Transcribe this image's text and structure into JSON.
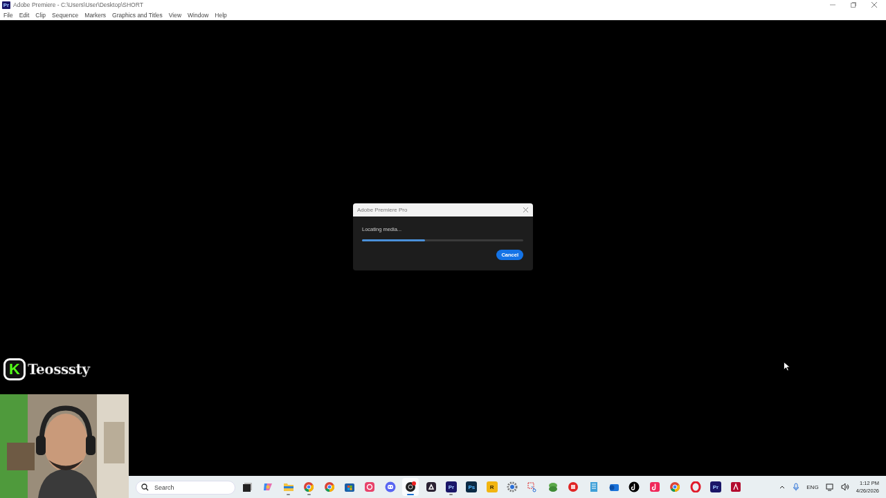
{
  "window": {
    "app_badge": "Pr",
    "title": "Adobe Premiere - C:\\Users\\User\\Desktop\\SHORT"
  },
  "menu": [
    "File",
    "Edit",
    "Clip",
    "Sequence",
    "Markers",
    "Graphics and Titles",
    "View",
    "Window",
    "Help"
  ],
  "dialog": {
    "title": "Adobe Premiere Pro",
    "message": "Locating media...",
    "level": 0.39,
    "button": "Cancel"
  },
  "overlay": {
    "logo_letter": "K",
    "channel": "Teosssty"
  },
  "taskbar": {
    "search": {
      "placeholder": "Search"
    },
    "apps": [
      {
        "kind": "taskview",
        "running": false,
        "selected": false
      },
      {
        "kind": "copilot",
        "running": false,
        "selected": false
      },
      {
        "kind": "folder",
        "running": true,
        "selected": false
      },
      {
        "kind": "chrome",
        "running": true,
        "selected": false
      },
      {
        "kind": "chrome",
        "running": false,
        "selected": false
      },
      {
        "kind": "store",
        "running": false,
        "selected": false
      },
      {
        "kind": "creative",
        "running": false,
        "selected": false
      },
      {
        "kind": "discord",
        "running": false,
        "selected": false
      },
      {
        "kind": "obs",
        "running": true,
        "selected": true
      },
      {
        "kind": "cloud",
        "running": false,
        "selected": false
      },
      {
        "kind": "premiere",
        "label": "Pr",
        "running": true,
        "selected": false
      },
      {
        "kind": "photoshop",
        "label": "Ps",
        "running": false,
        "selected": false
      },
      {
        "kind": "rockstar",
        "label": "R",
        "running": false,
        "selected": false
      },
      {
        "kind": "settings",
        "running": false,
        "selected": false
      },
      {
        "kind": "snip",
        "running": false,
        "selected": false
      },
      {
        "kind": "money",
        "running": false,
        "selected": false
      },
      {
        "kind": "redcircle",
        "running": false,
        "selected": false
      },
      {
        "kind": "notepad",
        "running": false,
        "selected": false
      },
      {
        "kind": "outlook",
        "running": false,
        "selected": false
      },
      {
        "kind": "tiktok",
        "running": false,
        "selected": false
      },
      {
        "kind": "tiktokpink",
        "running": false,
        "selected": false
      },
      {
        "kind": "chrome",
        "running": false,
        "selected": false
      },
      {
        "kind": "opera",
        "running": false,
        "selected": false
      },
      {
        "kind": "premiere",
        "label": "Pr",
        "running": false,
        "selected": false
      },
      {
        "kind": "acrobat",
        "running": false,
        "selected": false
      }
    ],
    "tray": {
      "language": "ENG",
      "time": "1:12 PM",
      "date": "4/26/2026"
    }
  }
}
